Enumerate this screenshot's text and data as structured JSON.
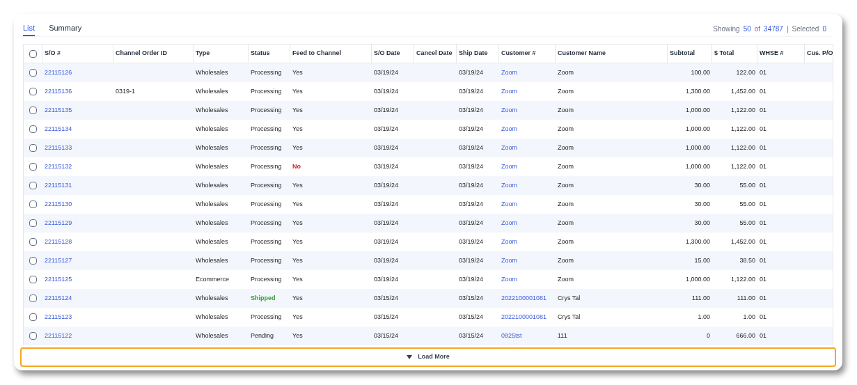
{
  "tabs": [
    {
      "label": "List",
      "selected": true
    },
    {
      "label": "Summary",
      "selected": false
    }
  ],
  "summary": {
    "showing_label": "Showing",
    "showing": "50",
    "of_label": "of",
    "total": "34787",
    "separator": "|",
    "selected_label": "Selected",
    "selected": "0"
  },
  "table": {
    "select_all": {
      "checked": false
    },
    "columns": [
      "S/O #",
      "Channel Order ID",
      "Type",
      "Status",
      "Feed to Channel",
      "S/O Date",
      "Cancel Date",
      "Ship Date",
      "Customer #",
      "Customer Name",
      "Subtotal",
      "$ Total",
      "WHSE #",
      "Cus. P/O"
    ],
    "rows": [
      {
        "checked": false,
        "so": "22115126",
        "type": "Wholesales",
        "status": {
          "text": "Processing",
          "kind": "normal"
        },
        "feed": {
          "text": "Yes",
          "kind": "normal"
        },
        "so_date": "03/19/24",
        "ship_date": "03/19/24",
        "customer_no": "Zoom",
        "customer_name": "Zoom",
        "subtotal": "100.00",
        "total": "122.00",
        "whse": "01"
      },
      {
        "checked": false,
        "so": "22115136",
        "channel_order_id": "0319-1",
        "type": "Wholesales",
        "status": {
          "text": "Processing",
          "kind": "normal"
        },
        "feed": {
          "text": "Yes",
          "kind": "normal"
        },
        "so_date": "03/19/24",
        "ship_date": "03/19/24",
        "customer_no": "Zoom",
        "customer_name": "Zoom",
        "subtotal": "1,300.00",
        "total": "1,452.00",
        "whse": "01"
      },
      {
        "checked": false,
        "so": "22115135",
        "type": "Wholesales",
        "status": {
          "text": "Processing",
          "kind": "normal"
        },
        "feed": {
          "text": "Yes",
          "kind": "normal"
        },
        "so_date": "03/19/24",
        "ship_date": "03/19/24",
        "customer_no": "Zoom",
        "customer_name": "Zoom",
        "subtotal": "1,000.00",
        "total": "1,122.00",
        "whse": "01"
      },
      {
        "checked": false,
        "so": "22115134",
        "type": "Wholesales",
        "status": {
          "text": "Processing",
          "kind": "normal"
        },
        "feed": {
          "text": "Yes",
          "kind": "normal"
        },
        "so_date": "03/19/24",
        "ship_date": "03/19/24",
        "customer_no": "Zoom",
        "customer_name": "Zoom",
        "subtotal": "1,000.00",
        "total": "1,122.00",
        "whse": "01"
      },
      {
        "checked": false,
        "so": "22115133",
        "type": "Wholesales",
        "status": {
          "text": "Processing",
          "kind": "normal"
        },
        "feed": {
          "text": "Yes",
          "kind": "normal"
        },
        "so_date": "03/19/24",
        "ship_date": "03/19/24",
        "customer_no": "Zoom",
        "customer_name": "Zoom",
        "subtotal": "1,000.00",
        "total": "1,122.00",
        "whse": "01"
      },
      {
        "checked": false,
        "so": "22115132",
        "type": "Wholesales",
        "status": {
          "text": "Processing",
          "kind": "normal"
        },
        "feed": {
          "text": "No",
          "kind": "error"
        },
        "so_date": "03/19/24",
        "ship_date": "03/19/24",
        "customer_no": "Zoom",
        "customer_name": "Zoom",
        "subtotal": "1,000.00",
        "total": "1,122.00",
        "whse": "01"
      },
      {
        "checked": false,
        "so": "22115131",
        "type": "Wholesales",
        "status": {
          "text": "Processing",
          "kind": "normal"
        },
        "feed": {
          "text": "Yes",
          "kind": "normal"
        },
        "so_date": "03/19/24",
        "ship_date": "03/19/24",
        "customer_no": "Zoom",
        "customer_name": "Zoom",
        "subtotal": "30.00",
        "total": "55.00",
        "whse": "01"
      },
      {
        "checked": false,
        "so": "22115130",
        "type": "Wholesales",
        "status": {
          "text": "Processing",
          "kind": "normal"
        },
        "feed": {
          "text": "Yes",
          "kind": "normal"
        },
        "so_date": "03/19/24",
        "ship_date": "03/19/24",
        "customer_no": "Zoom",
        "customer_name": "Zoom",
        "subtotal": "30.00",
        "total": "55.00",
        "whse": "01"
      },
      {
        "checked": false,
        "so": "22115129",
        "type": "Wholesales",
        "status": {
          "text": "Processing",
          "kind": "normal"
        },
        "feed": {
          "text": "Yes",
          "kind": "normal"
        },
        "so_date": "03/19/24",
        "ship_date": "03/19/24",
        "customer_no": "Zoom",
        "customer_name": "Zoom",
        "subtotal": "30.00",
        "total": "55.00",
        "whse": "01"
      },
      {
        "checked": false,
        "so": "22115128",
        "type": "Wholesales",
        "status": {
          "text": "Processing",
          "kind": "normal"
        },
        "feed": {
          "text": "Yes",
          "kind": "normal"
        },
        "so_date": "03/19/24",
        "ship_date": "03/19/24",
        "customer_no": "Zoom",
        "customer_name": "Zoom",
        "subtotal": "1,300.00",
        "total": "1,452.00",
        "whse": "01"
      },
      {
        "checked": false,
        "so": "22115127",
        "type": "Wholesales",
        "status": {
          "text": "Processing",
          "kind": "normal"
        },
        "feed": {
          "text": "Yes",
          "kind": "normal"
        },
        "so_date": "03/19/24",
        "ship_date": "03/19/24",
        "customer_no": "Zoom",
        "customer_name": "Zoom",
        "subtotal": "15.00",
        "total": "38.50",
        "whse": "01"
      },
      {
        "checked": false,
        "so": "22115125",
        "type": "Ecommerce",
        "status": {
          "text": "Processing",
          "kind": "normal"
        },
        "feed": {
          "text": "Yes",
          "kind": "normal"
        },
        "so_date": "03/19/24",
        "ship_date": "03/19/24",
        "customer_no": "Zoom",
        "customer_name": "Zoom",
        "subtotal": "1,000.00",
        "total": "1,122.00",
        "whse": "01"
      },
      {
        "checked": false,
        "so": "22115124",
        "type": "Wholesales",
        "status": {
          "text": "Shipped",
          "kind": "success"
        },
        "feed": {
          "text": "Yes",
          "kind": "normal"
        },
        "so_date": "03/15/24",
        "ship_date": "03/15/24",
        "customer_no": "2022100001081",
        "customer_name": "Crys Tal",
        "subtotal": "111.00",
        "total": "111.00",
        "whse": "01"
      },
      {
        "checked": false,
        "so": "22115123",
        "type": "Wholesales",
        "status": {
          "text": "Processing",
          "kind": "normal"
        },
        "feed": {
          "text": "Yes",
          "kind": "normal"
        },
        "so_date": "03/15/24",
        "ship_date": "03/15/24",
        "customer_no": "2022100001081",
        "customer_name": "Crys Tal",
        "subtotal": "1.00",
        "total": "1.00",
        "whse": "01"
      },
      {
        "checked": false,
        "so": "22115122",
        "type": "Wholesales",
        "status": {
          "text": "Pending",
          "kind": "normal"
        },
        "feed": {
          "text": "Yes",
          "kind": "normal"
        },
        "so_date": "03/15/24",
        "ship_date": "03/15/24",
        "customer_no": "0925tst",
        "customer_name": "111",
        "subtotal": "0",
        "total": "666.00",
        "whse": "01"
      }
    ]
  },
  "load_more": {
    "label": "Load More"
  }
}
